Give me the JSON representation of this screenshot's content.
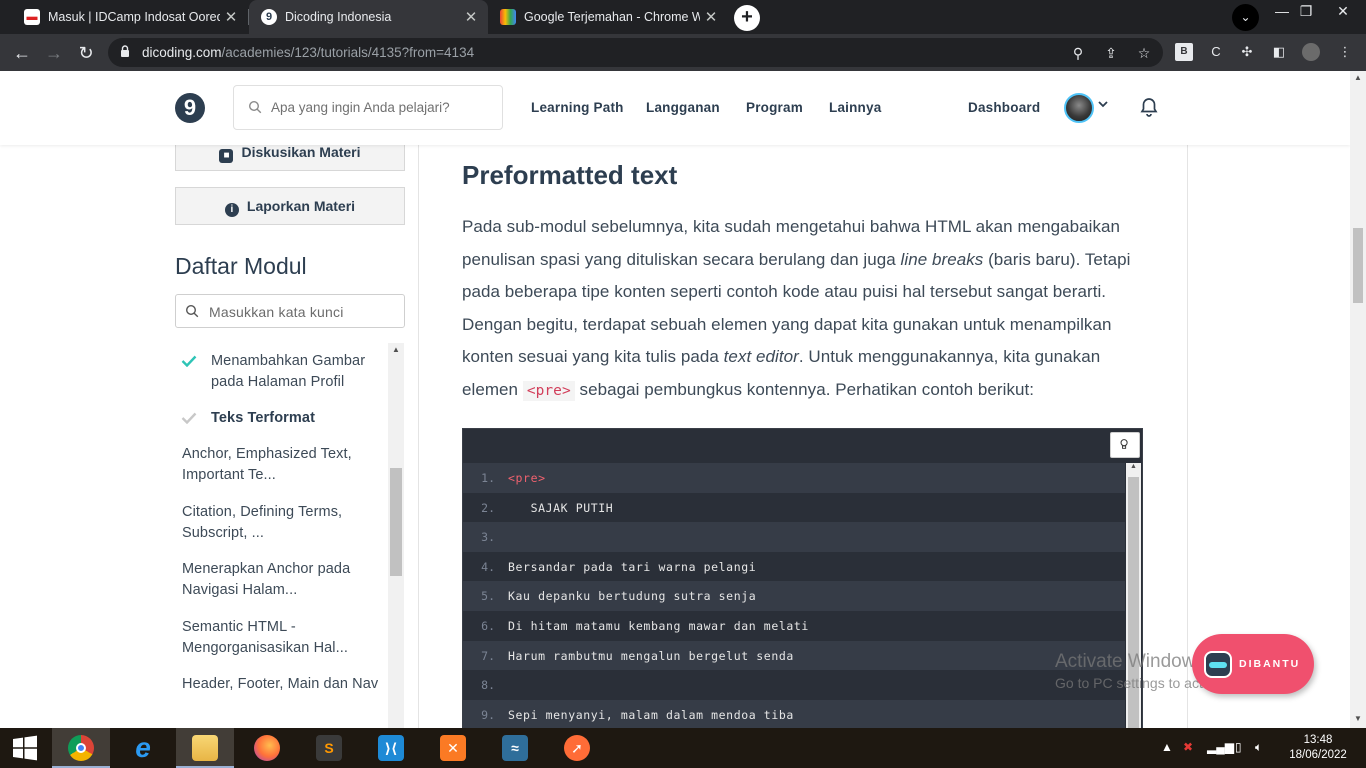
{
  "browser": {
    "tabs": [
      {
        "title": "Masuk | IDCamp Indosat Ooredoo",
        "favicon": "idcamp-icon",
        "state": "inactive"
      },
      {
        "title": "Dicoding Indonesia",
        "favicon": "dicoding-icon",
        "state": "active"
      },
      {
        "title": "Google Terjemahan - Chrome Web",
        "favicon": "translate-icon",
        "state": "inactive"
      }
    ],
    "url_host": "dicoding.com",
    "url_path": "/academies/123/tutorials/4135?from=4134"
  },
  "header": {
    "logo_text": "9",
    "search_placeholder": "Apa yang ingin Anda pelajari?",
    "nav": [
      "Learning Path",
      "Langganan",
      "Program",
      "Lainnya"
    ],
    "dashboard": "Dashboard"
  },
  "sidebar": {
    "discuss_label": "Diskusikan Materi",
    "report_label": "Laporkan Materi",
    "daftar_title": "Daftar Modul",
    "keyword_placeholder": "Masukkan kata kunci",
    "modules": [
      {
        "label": "Menambahkan Gambar pada Halaman Profil",
        "checked": true,
        "bold": false
      },
      {
        "label": "Teks Terformat",
        "checked": true,
        "bold": true
      },
      {
        "label": "Anchor, Emphasized Text, Important Te...",
        "checked": false,
        "bold": false
      },
      {
        "label": "Citation, Defining Terms, Subscript, ...",
        "checked": false,
        "bold": false
      },
      {
        "label": "Menerapkan Anchor pada Navigasi Halam...",
        "checked": false,
        "bold": false
      },
      {
        "label": "Semantic HTML - Mengorganisasikan Hal...",
        "checked": false,
        "bold": false
      },
      {
        "label": "Header, Footer, Main dan Nav",
        "checked": false,
        "bold": false
      }
    ]
  },
  "content": {
    "heading": "Preformatted text",
    "para_1": "Pada sub-modul sebelumnya, kita sudah mengetahui bahwa HTML akan mengabaikan penulisan spasi yang dituliskan secara berulang dan juga ",
    "para_em_1": "line breaks",
    "para_2": " (baris baru). Tetapi pada beberapa tipe konten seperti contoh kode atau puisi hal tersebut sangat berarti. Dengan begitu, terdapat sebuah elemen yang dapat kita gunakan untuk menampilkan konten sesuai yang kita tulis pada ",
    "para_em_2": "text editor",
    "para_3": ". Untuk menggunakannya, kita gunakan elemen ",
    "para_code": "<pre>",
    "para_4": " sebagai pembungkus kontennya. Perhatikan contoh berikut:",
    "code_lines": [
      {
        "n": "1.",
        "text": "<pre>",
        "tag": true
      },
      {
        "n": "2.",
        "text": "   SAJAK PUTIH",
        "tag": false
      },
      {
        "n": "3.",
        "text": "",
        "tag": false
      },
      {
        "n": "4.",
        "text": "Bersandar pada tari warna pelangi",
        "tag": false
      },
      {
        "n": "5.",
        "text": "Kau depanku bertudung sutra senja",
        "tag": false
      },
      {
        "n": "6.",
        "text": "Di hitam matamu kembang mawar dan melati",
        "tag": false
      },
      {
        "n": "7.",
        "text": "Harum rambutmu mengalun bergelut senda",
        "tag": false
      },
      {
        "n": "8.",
        "text": "",
        "tag": false
      },
      {
        "n": "9.",
        "text": "Sepi menyanyi, malam dalam mendoa tiba",
        "tag": false
      }
    ]
  },
  "overlay": {
    "activate_title": "Activate Windows",
    "activate_sub": "Go to PC settings to activate Windows.",
    "dibantu_label": "DIBANTU"
  },
  "taskbar": {
    "apps": [
      "chrome-icon",
      "internet-explorer-icon",
      "file-explorer-icon",
      "firefox-icon",
      "sublime-text-icon",
      "vscode-icon",
      "xampp-icon",
      "mysql-workbench-icon",
      "postman-icon"
    ],
    "time": "13:48",
    "date": "18/06/2022"
  },
  "colors": {
    "brand_dark": "#2d3e50",
    "check_green": "#2ec4b6",
    "code_bg": "#2a2f38",
    "dibantu_pink": "#f0506e"
  }
}
